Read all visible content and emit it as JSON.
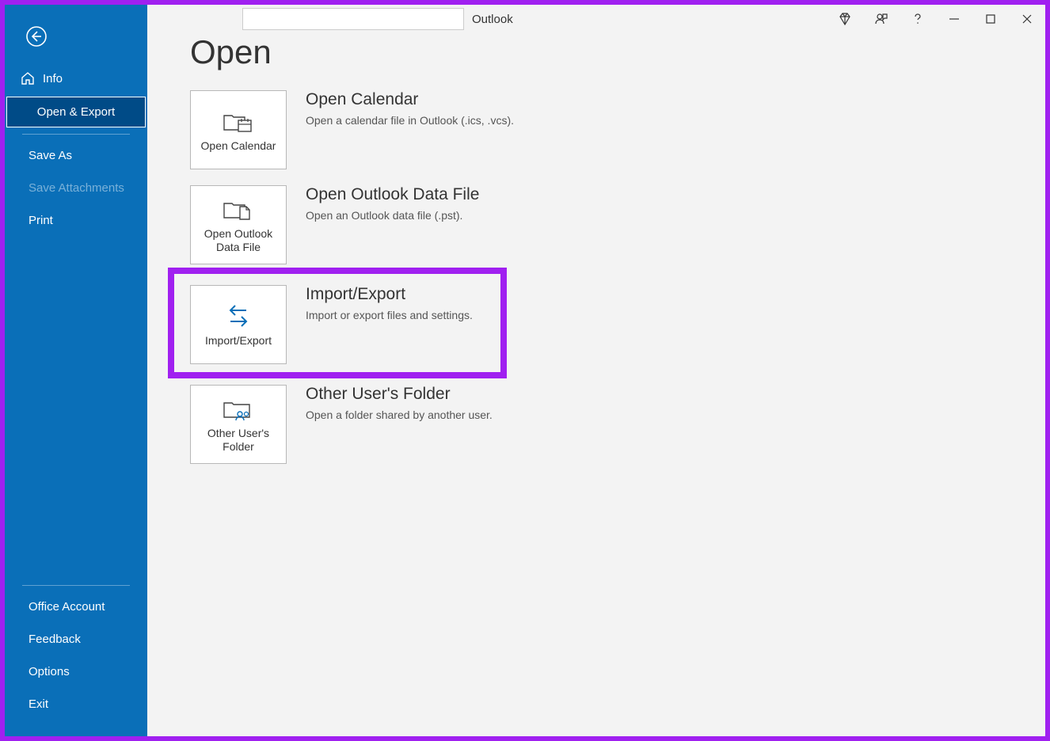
{
  "titlebar": {
    "app_name": "Outlook"
  },
  "sidebar": {
    "items": {
      "info": "Info",
      "open_export": "Open & Export",
      "save_as": "Save As",
      "save_attachments": "Save Attachments",
      "print": "Print",
      "office_account": "Office Account",
      "feedback": "Feedback",
      "options": "Options",
      "exit": "Exit"
    }
  },
  "main": {
    "title": "Open",
    "options": [
      {
        "tile_label": "Open Calendar",
        "heading": "Open Calendar",
        "desc": "Open a calendar file in Outlook (.ics, .vcs)."
      },
      {
        "tile_label": "Open Outlook Data File",
        "heading": "Open Outlook Data File",
        "desc": "Open an Outlook data file (.pst)."
      },
      {
        "tile_label": "Import/Export",
        "heading": "Import/Export",
        "desc": "Import or export files and settings."
      },
      {
        "tile_label": "Other User's Folder",
        "heading": "Other User's Folder",
        "desc": "Open a folder shared by another user."
      }
    ]
  }
}
